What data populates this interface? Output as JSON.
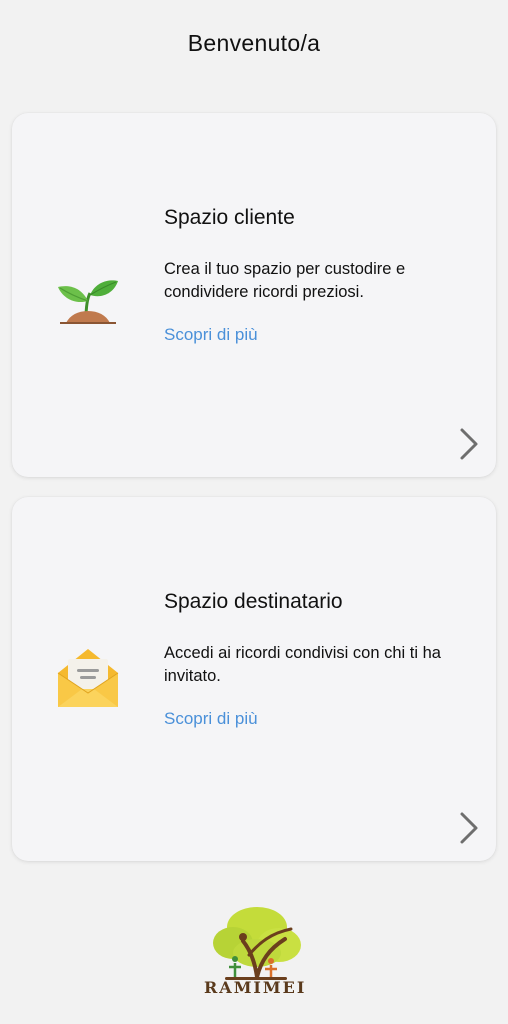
{
  "header": {
    "title": "Benvenuto/a"
  },
  "cards": [
    {
      "title": "Spazio cliente",
      "description": "Crea il tuo spazio per custodire e condividere ricordi preziosi.",
      "link": "Scopri di più",
      "icon": "sprout-icon"
    },
    {
      "title": "Spazio destinatario",
      "description": "Accedi ai ricordi condivisi con chi ti ha invitato.",
      "link": "Scopri di più",
      "icon": "envelope-icon"
    }
  ],
  "footer": {
    "logo_text": "RAMIMEI"
  },
  "colors": {
    "background": "#f2f2f2",
    "card": "#f5f5f7",
    "link": "#4a90d9",
    "chevron": "#6e6e6e",
    "logo_text": "#5a3a1c"
  }
}
